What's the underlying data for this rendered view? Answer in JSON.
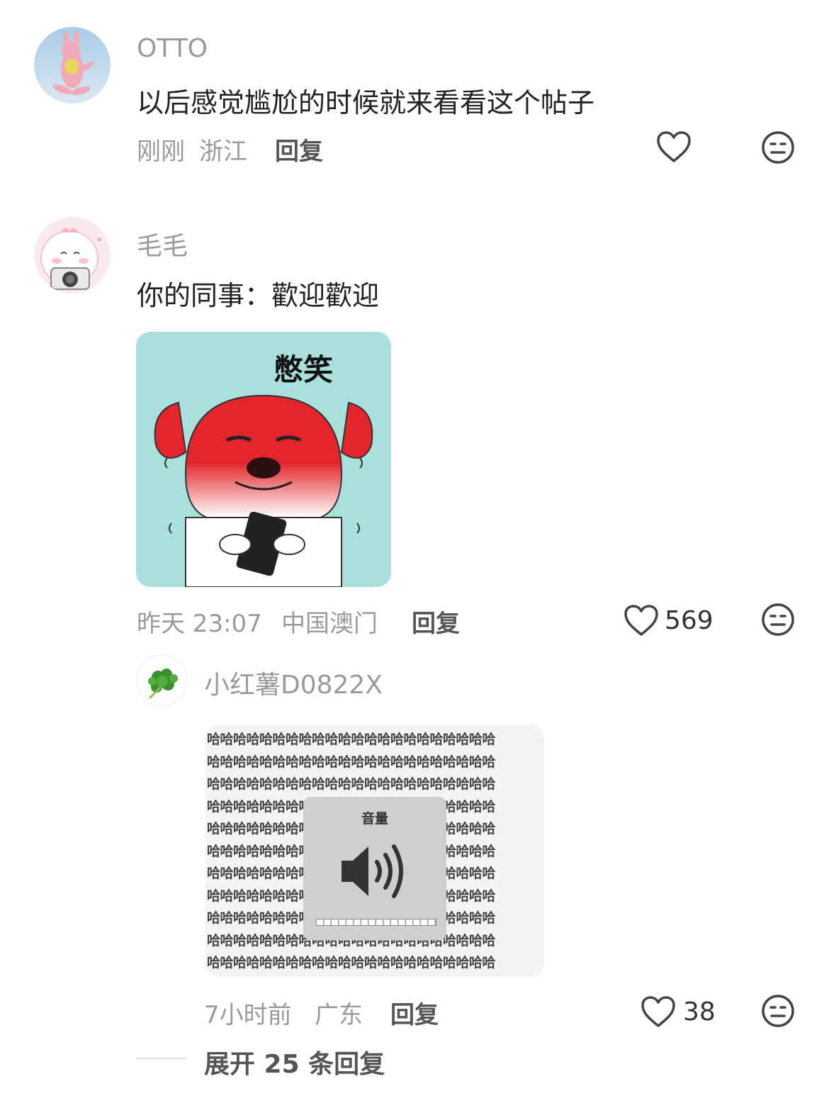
{
  "comments": [
    {
      "user": "OTTO",
      "text": "以后感觉尴尬的时候就来看看这个帖子",
      "time": "刚刚",
      "location": "浙江",
      "reply_label": "回复",
      "likes": ""
    },
    {
      "user": "毛毛",
      "text": "你的同事：歡迎歡迎",
      "sticker_caption": "憋笑",
      "time": "昨天 23:07",
      "location": "中国澳门",
      "reply_label": "回复",
      "likes": "569",
      "sub_reply": {
        "user": "小红薯D0822X",
        "image_text": "哈",
        "volume_label": "音量",
        "time": "7小时前",
        "location": "广东",
        "reply_label": "回复",
        "likes": "38"
      }
    }
  ],
  "expand_replies": "展开 25 条回复",
  "icons": {
    "like": "heart-outline-icon",
    "dislike": "meh-face-icon",
    "volume": "speaker-icon"
  },
  "colors": {
    "sticker_bg": "#a9e0dc",
    "dog_red": "#e3262b",
    "meta_gray": "#9a9a9a"
  }
}
